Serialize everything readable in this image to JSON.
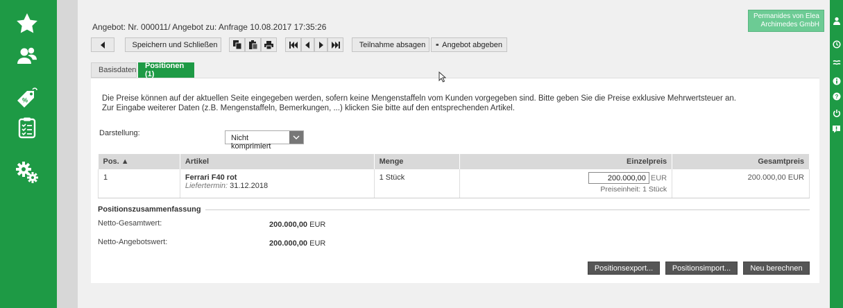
{
  "header": {
    "title": "Angebot: Nr. 000011/ Angebot zu: Anfrage 10.08.2017 17:35:26",
    "user_line1": "Permanides von Elea",
    "user_line2": "Archimedes GmbH"
  },
  "toolbar": {
    "save_close": "Speichern und Schließen",
    "decline": "Teilnahme absagen",
    "submit": "Angebot abgeben"
  },
  "tabs": {
    "basisdaten": "Basisdaten",
    "positionen": "Positionen (1)"
  },
  "info": {
    "line1": "Die Preise können auf der aktuellen Seite eingegeben werden, sofern keine Mengenstaffeln vom Kunden vorgegeben sind. Bitte geben Sie die Preise exklusive Mehrwertsteuer an.",
    "line2": "Zur Eingabe weiterer Daten (z.B. Mengenstaffeln, Bemerkungen, ...) klicken Sie bitte auf den entsprechenden Artikel."
  },
  "darstellung": {
    "label": "Darstellung:",
    "value": "Nicht komprimiert"
  },
  "table": {
    "headers": {
      "pos": "Pos. ▲",
      "artikel": "Artikel",
      "menge": "Menge",
      "einzelpreis": "Einzelpreis",
      "gesamtpreis": "Gesamtpreis"
    },
    "rows": [
      {
        "pos": "1",
        "artikel": "Ferrari F40 rot",
        "liefer_label": "Liefertermin:",
        "liefer_date": "31.12.2018",
        "menge": "1 Stück",
        "einzelpreis": "200.000,00",
        "currency": "EUR",
        "preiseinheit": "Preiseinheit: 1 Stück",
        "gesamtpreis": "200.000,00 EUR"
      }
    ]
  },
  "summary": {
    "title": "Positionszusammenfassung",
    "netto_gesamt_label": "Netto-Gesamtwert:",
    "netto_gesamt_value": "200.000,00",
    "netto_angebot_label": "Netto-Angebotswert:",
    "netto_angebot_value": "200.000,00",
    "currency": "EUR"
  },
  "buttons": {
    "export": "Positionsexport...",
    "import": "Positionsimport...",
    "recalc": "Neu berechnen"
  },
  "colors": {
    "brand_green": "#1e9a45",
    "user_box": "#6ccb94"
  }
}
